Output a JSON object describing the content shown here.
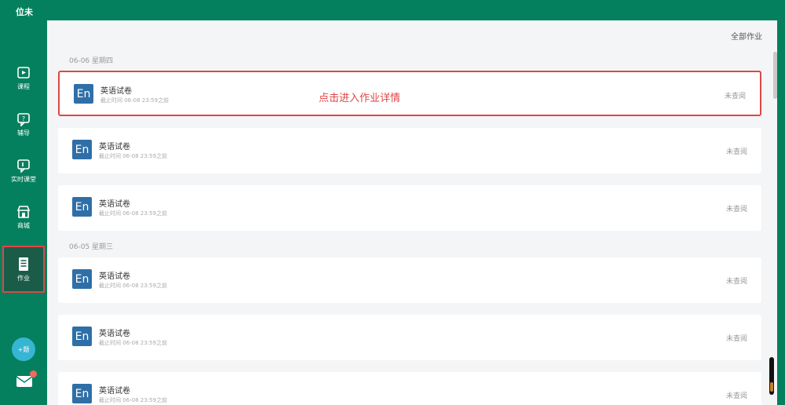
{
  "app": {
    "title": "位未"
  },
  "sidebar": {
    "items": [
      {
        "label": "课程",
        "icon": "course-icon"
      },
      {
        "label": "辅导",
        "icon": "tutoring-icon"
      },
      {
        "label": "实时课堂",
        "icon": "live-class-icon"
      },
      {
        "label": "商城",
        "icon": "store-icon"
      },
      {
        "label": "作业",
        "icon": "homework-icon",
        "active": true
      }
    ],
    "plus_label": "+题",
    "mail_icon": "mail-icon"
  },
  "main": {
    "filter_label": "全部作业",
    "annotation": "点击进入作业详情",
    "groups": [
      {
        "date": "06-06 星期四",
        "items": [
          {
            "subject": "En",
            "title": "英语试卷",
            "meta": "截止时间 06-08 23:59之前",
            "status": "未查阅",
            "highlighted": true
          },
          {
            "subject": "En",
            "title": "英语试卷",
            "meta": "截止时间 06-08 23:59之前",
            "status": "未查阅"
          },
          {
            "subject": "En",
            "title": "英语试卷",
            "meta": "截止时间 06-08 23:59之前",
            "status": "未查阅"
          }
        ]
      },
      {
        "date": "06-05 星期三",
        "items": [
          {
            "subject": "En",
            "title": "英语试卷",
            "meta": "截止时间 06-08 23:59之前",
            "status": "未查阅"
          },
          {
            "subject": "En",
            "title": "英语试卷",
            "meta": "截止时间 06-08 23:59之前",
            "status": "未查阅"
          },
          {
            "subject": "En",
            "title": "英语试卷",
            "meta": "截止时间 06-08 23:59之前",
            "status": "未查阅"
          }
        ]
      }
    ]
  },
  "colors": {
    "primary": "#05805e",
    "highlight": "#e04545",
    "badge": "#2f6fa7",
    "plus_button": "#36b6d3"
  }
}
